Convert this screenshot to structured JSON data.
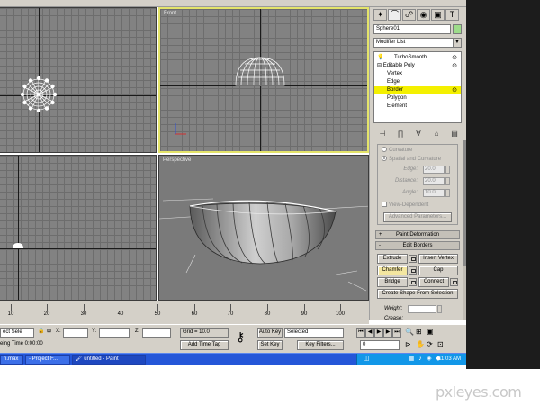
{
  "viewports": {
    "top": {
      "label": ""
    },
    "front": {
      "label": "Front"
    },
    "left": {
      "label": ""
    },
    "perspective": {
      "label": "Perspective"
    }
  },
  "command_panel": {
    "tabs": [
      {
        "icon": "create-tab-icon",
        "glyph": "✦"
      },
      {
        "icon": "modify-tab-icon",
        "glyph": "⌒"
      },
      {
        "icon": "hierarchy-tab-icon",
        "glyph": "☍"
      },
      {
        "icon": "motion-tab-icon",
        "glyph": "◉"
      },
      {
        "icon": "display-tab-icon",
        "glyph": "▣"
      },
      {
        "icon": "utilities-tab-icon",
        "glyph": "T"
      }
    ],
    "object_name": "Sphere01",
    "object_color": "#9ddc8a",
    "modifier_list": "Modifier List",
    "stack": [
      {
        "label": "TurboSmooth",
        "indent": 0,
        "selected": false
      },
      {
        "label": "Editable Poly",
        "indent": 0,
        "selected": false
      },
      {
        "label": "Vertex",
        "indent": 1,
        "selected": false
      },
      {
        "label": "Edge",
        "indent": 1,
        "selected": false
      },
      {
        "label": "Border",
        "indent": 1,
        "selected": true
      },
      {
        "label": "Polygon",
        "indent": 1,
        "selected": false
      },
      {
        "label": "Element",
        "indent": 1,
        "selected": false
      }
    ],
    "selection": {
      "curvature": "Curvature",
      "spatial": "Spatial and Curvature",
      "edge_label": "Edge:",
      "edge_value": "20.0",
      "distance_label": "Distance:",
      "distance_value": "20.0",
      "angle_label": "Angle:",
      "angle_value": "10.0",
      "view_dependent": "View-Dependent",
      "advanced": "Advanced Parameters..."
    },
    "paint_deformation": {
      "sign": "+",
      "title": "Paint Deformation"
    },
    "edit_borders": {
      "sign": "-",
      "title": "Edit Borders",
      "extrude": "Extrude",
      "insert_vertex": "Insert Vertex",
      "chamfer": "Chamfer",
      "cap": "Cap",
      "bridge": "Bridge",
      "connect": "Connect",
      "create_shape": "Create Shape From Selection",
      "weight": "Weight:",
      "crease": "Crease:"
    }
  },
  "timeline": {
    "ticks": [
      "10",
      "20",
      "30",
      "40",
      "50",
      "60",
      "70",
      "80",
      "90",
      "100"
    ]
  },
  "statusbar": {
    "selection_text": "ect Sele",
    "x_label": "X:",
    "y_label": "Y:",
    "z_label": "Z:",
    "grid": "Grid = 10.0",
    "time_tag": "Add Time Tag",
    "rendering_time": "eing Time  0:00:00",
    "auto_key": "Auto Key",
    "set_key": "Set Key",
    "key_mode": "Selected",
    "key_filters": "Key Filters...",
    "frame": "0"
  },
  "taskbar": {
    "items": [
      "n.max",
      "- Project F...",
      "untitled - Paint"
    ],
    "clock": "11:03 AM"
  },
  "watermark": "pxleyes.com"
}
